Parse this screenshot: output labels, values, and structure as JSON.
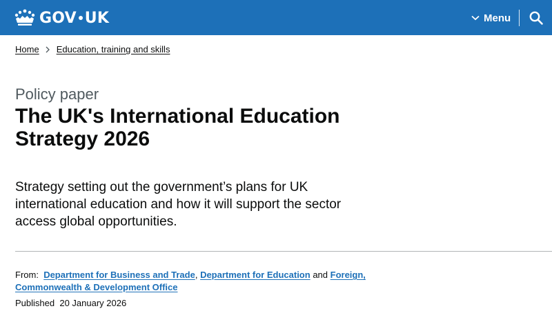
{
  "header": {
    "logo_text_left": "GOV",
    "logo_text_right": "UK",
    "menu_label": "Menu",
    "icons": {
      "logo": "crown-icon",
      "menu": "chevron-down-icon",
      "search": "search-icon"
    },
    "colors": {
      "background": "#1d70b8",
      "foreground": "#ffffff"
    }
  },
  "breadcrumbs": [
    {
      "label": "Home"
    },
    {
      "label": "Education, training and skills"
    }
  ],
  "document": {
    "caption": "Policy paper",
    "title": "The UK's International Education Strategy 2026",
    "summary": "Strategy setting out the government’s plans for UK international education and how it will support the sector access global opportunities."
  },
  "metadata": {
    "from_label": "From:",
    "organisations": [
      "Department for Business and Trade",
      "Department for Education",
      "Foreign, Commonwealth & Development Office"
    ],
    "separator": ",",
    "conjunction": "and",
    "published_label": "Published",
    "published_date": "20 January 2026"
  },
  "colors": {
    "link": "#1d70b8",
    "text": "#0b0c0c",
    "secondary_text": "#505a5f",
    "border": "#b1b4b6"
  }
}
